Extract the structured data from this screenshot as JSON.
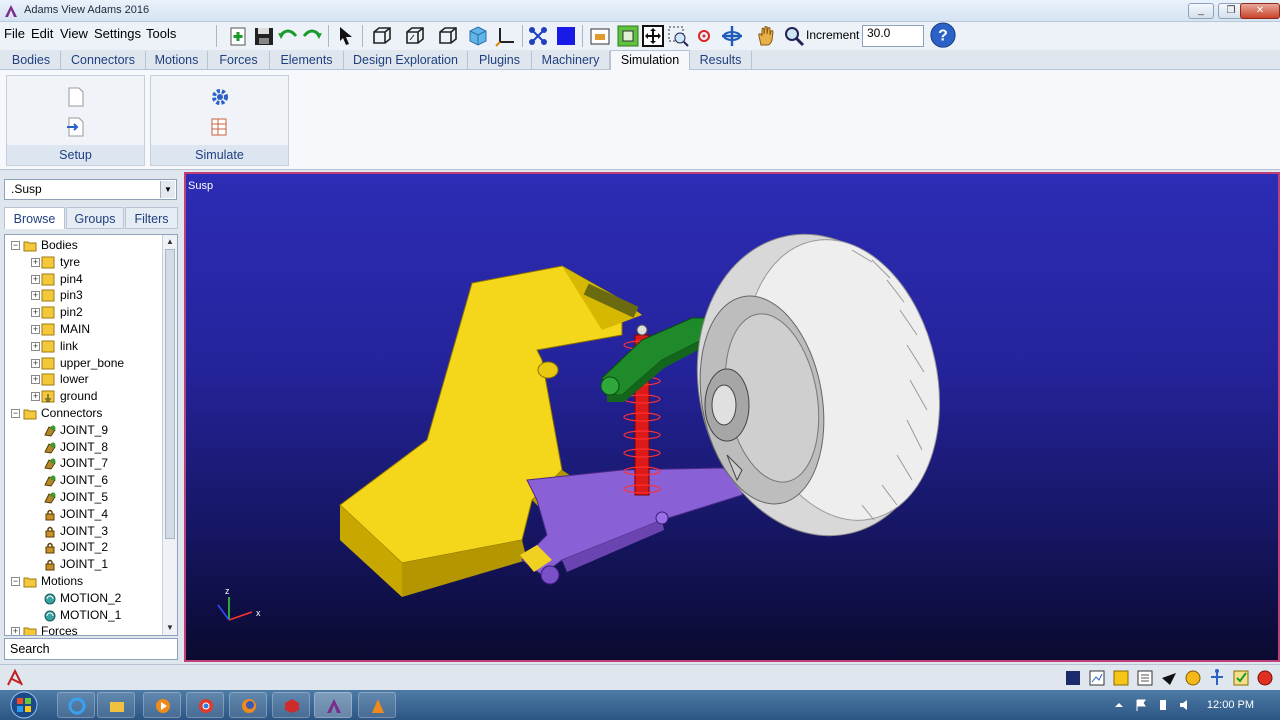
{
  "window": {
    "title": "Adams View Adams 2016",
    "minimize": "_",
    "maximize": "❐",
    "close": "✕"
  },
  "menu": [
    "File",
    "Edit",
    "View",
    "Settings",
    "Tools"
  ],
  "toolbar": {
    "increment_label": "Increment",
    "increment_value": "30.0"
  },
  "tabs": [
    "Bodies",
    "Connectors",
    "Motions",
    "Forces",
    "Elements",
    "Design Exploration",
    "Plugins",
    "Machinery",
    "Simulation",
    "Results"
  ],
  "active_tab": "Simulation",
  "ribbon": {
    "groups": [
      "Setup",
      "Simulate"
    ]
  },
  "browser": {
    "model": ".Susp",
    "tabs": [
      "Browse",
      "Groups",
      "Filters"
    ],
    "tree": [
      {
        "label": "Bodies",
        "type": "folder",
        "expander": "−"
      },
      {
        "label": "tyre",
        "type": "part",
        "expander": "+"
      },
      {
        "label": "pin4",
        "type": "part",
        "expander": "+"
      },
      {
        "label": "pin3",
        "type": "part",
        "expander": "+"
      },
      {
        "label": "pin2",
        "type": "part",
        "expander": "+"
      },
      {
        "label": "MAIN",
        "type": "part",
        "expander": "+"
      },
      {
        "label": "link",
        "type": "part",
        "expander": "+"
      },
      {
        "label": "upper_bone",
        "type": "part",
        "expander": "+"
      },
      {
        "label": "lower",
        "type": "part",
        "expander": "+"
      },
      {
        "label": "ground",
        "type": "ground",
        "expander": "+"
      },
      {
        "label": "Connectors",
        "type": "folder",
        "expander": "−"
      },
      {
        "label": "JOINT_9",
        "type": "joint",
        "expander": ""
      },
      {
        "label": "JOINT_8",
        "type": "joint",
        "expander": ""
      },
      {
        "label": "JOINT_7",
        "type": "joint",
        "expander": ""
      },
      {
        "label": "JOINT_6",
        "type": "joint",
        "expander": ""
      },
      {
        "label": "JOINT_5",
        "type": "joint",
        "expander": ""
      },
      {
        "label": "JOINT_4",
        "type": "lock",
        "expander": ""
      },
      {
        "label": "JOINT_3",
        "type": "lock",
        "expander": ""
      },
      {
        "label": "JOINT_2",
        "type": "lock",
        "expander": ""
      },
      {
        "label": "JOINT_1",
        "type": "lock",
        "expander": ""
      },
      {
        "label": "Motions",
        "type": "folder",
        "expander": "−"
      },
      {
        "label": "MOTION_2",
        "type": "motion",
        "expander": ""
      },
      {
        "label": "MOTION_1",
        "type": "motion",
        "expander": ""
      },
      {
        "label": "Forces",
        "type": "folder",
        "expander": "+"
      }
    ],
    "search_placeholder": "Search"
  },
  "viewport": {
    "model_label": "Susp",
    "axes": {
      "x": "x",
      "z": "z"
    }
  },
  "taskbar": {
    "clock": "12:00 PM"
  },
  "colors": {
    "accent": "#1f3f80",
    "viewport_top": "#2c2cb6",
    "viewport_border": "#c0407a"
  }
}
